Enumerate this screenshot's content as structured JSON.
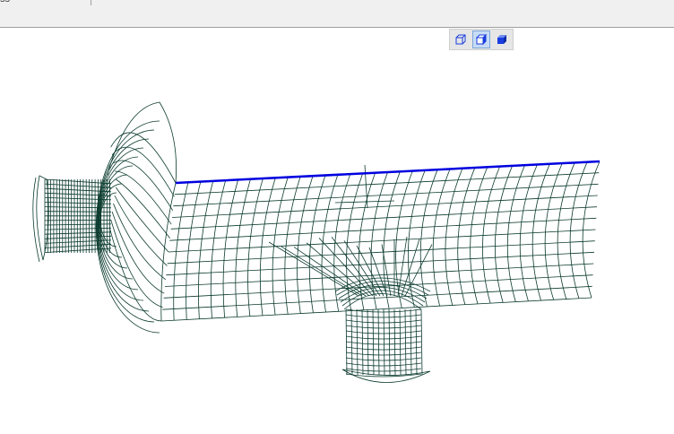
{
  "toolbar": {
    "cut_label": "ss"
  },
  "view_buttons": [
    {
      "name": "wireframe-view-button",
      "icon": "wireframe-cube-icon",
      "active": false
    },
    {
      "name": "hidden-line-view-button",
      "icon": "hidden-line-cube-icon",
      "active": true
    },
    {
      "name": "shaded-view-button",
      "icon": "shaded-cube-icon",
      "active": false
    }
  ],
  "colors": {
    "mesh": "#0b3b2e",
    "highlight_edge": "#0000e0",
    "shade": "#1a3de0"
  }
}
